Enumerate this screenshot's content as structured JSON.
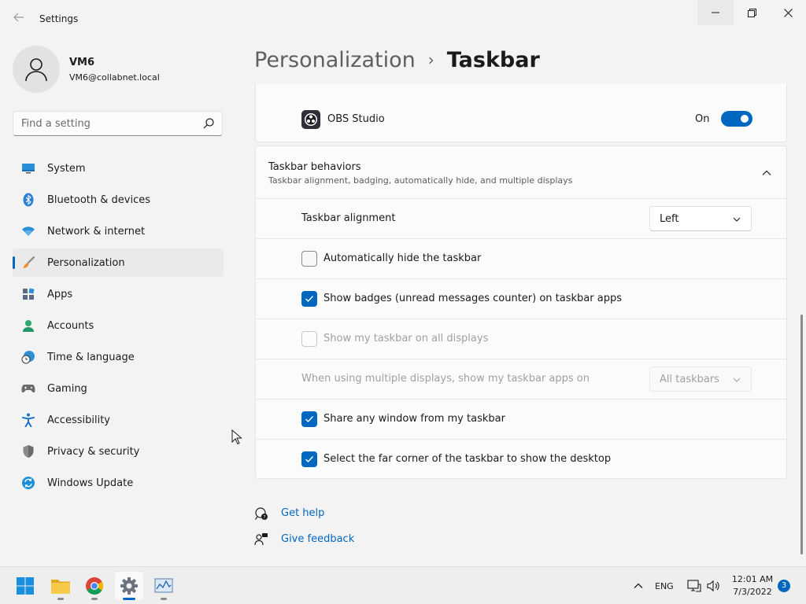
{
  "window": {
    "title": "Settings",
    "back_icon": "arrow-left-icon",
    "controls": [
      "minimize-icon",
      "maximize-icon",
      "close-icon"
    ]
  },
  "profile": {
    "name": "VM6",
    "email": "VM6@collabnet.local"
  },
  "search": {
    "placeholder": "Find a setting",
    "value": ""
  },
  "sidebar": {
    "items": [
      {
        "label": "System",
        "icon": "monitor-icon",
        "active": false
      },
      {
        "label": "Bluetooth & devices",
        "icon": "bluetooth-icon",
        "active": false
      },
      {
        "label": "Network & internet",
        "icon": "wifi-icon",
        "active": false
      },
      {
        "label": "Personalization",
        "icon": "paintbrush-icon",
        "active": true
      },
      {
        "label": "Apps",
        "icon": "apps-icon",
        "active": false
      },
      {
        "label": "Accounts",
        "icon": "person-icon",
        "active": false
      },
      {
        "label": "Time & language",
        "icon": "clock-globe-icon",
        "active": false
      },
      {
        "label": "Gaming",
        "icon": "gamepad-icon",
        "active": false
      },
      {
        "label": "Accessibility",
        "icon": "accessibility-icon",
        "active": false
      },
      {
        "label": "Privacy & security",
        "icon": "shield-icon",
        "active": false
      },
      {
        "label": "Windows Update",
        "icon": "sync-icon",
        "active": false
      }
    ]
  },
  "breadcrumb": {
    "parent": "Personalization",
    "separator": "›",
    "current": "Taskbar"
  },
  "obs": {
    "label": "OBS Studio",
    "state_text": "On",
    "enabled": true
  },
  "behaviors": {
    "title": "Taskbar behaviors",
    "subtitle": "Taskbar alignment, badging, automatically hide, and multiple displays",
    "alignment": {
      "label": "Taskbar alignment",
      "value": "Left"
    },
    "auto_hide": {
      "label": "Automatically hide the taskbar",
      "checked": false
    },
    "badges": {
      "label": "Show badges (unread messages counter) on taskbar apps",
      "checked": true
    },
    "all_displays": {
      "label": "Show my taskbar on all displays",
      "checked": false,
      "disabled": true
    },
    "multi_display": {
      "label": "When using multiple displays, show my taskbar apps on",
      "value": "All taskbars",
      "disabled": true
    },
    "share_window": {
      "label": "Share any window from my taskbar",
      "checked": true
    },
    "far_corner": {
      "label": "Select the far corner of the taskbar to show the desktop",
      "checked": true
    }
  },
  "links": {
    "help": "Get help",
    "feedback": "Give feedback"
  },
  "taskbar": {
    "apps": [
      "windows-start-icon",
      "file-explorer-icon",
      "chrome-icon",
      "settings-gear-icon",
      "performance-monitor-icon"
    ],
    "tray": {
      "language": "ENG",
      "time": "12:01 AM",
      "date": "7/3/2022",
      "notification_count": "3"
    }
  },
  "colors": {
    "accent": "#0067c0",
    "background": "#f3f3f3",
    "card": "#fbfbfb"
  }
}
